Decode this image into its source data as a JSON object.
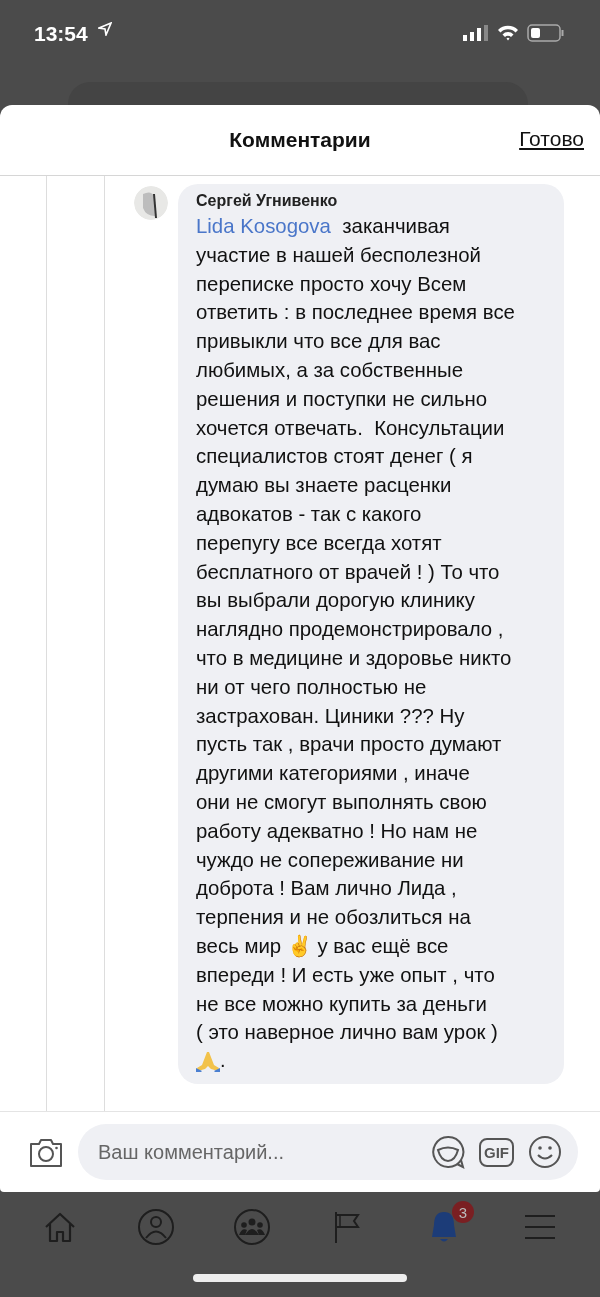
{
  "status_bar": {
    "time": "13:54"
  },
  "sheet": {
    "title": "Комментарии",
    "done_button": "Готово"
  },
  "comment": {
    "author": "Сергей Угнивенко",
    "mention": "Lida Kosogova",
    "text": "  заканчивая\nучастие в нашей бесполезной\nпереписке просто хочу Всем\nответить : в последнее время все\nпривыкли что все для вас\nлюбимых, а за собственные\nрешения и поступки не сильно\nхочется отвечать.  Консультации\nспециалистов стоят денег ( я\nдумаю вы знаете расценки\nадвокатов - так с какого\nперепугу все всегда хотят\nбесплатного от врачей ! ) То что\nвы выбрали дорогую клинику\nнаглядно продемонстрировало ,\nчто в медицине и здоровье никто\nни от чего полностью не\nзастрахован. Циники ??? Ну\nпусть так , врачи просто думают\nдругими категориями , иначе\nони не смогут выполнять свою\nработу адекватно ! Но нам не\nчуждо не сопереживание ни\nдоброта ! Вам лично Лида ,\nтерпения и не обозлиться на\nвесь мир ✌ у вас ещё все\nвпереди ! И есть уже опыт , что\nне все можно купить за деньги\n( это наверное лично вам урок )",
    "closing": "."
  },
  "composer": {
    "placeholder": "Ваш комментарий...",
    "gif_label": "GIF"
  },
  "tab_bar": {
    "items": [
      {
        "kind": "home",
        "selected": false
      },
      {
        "kind": "profile",
        "selected": false
      },
      {
        "kind": "groups",
        "selected": false
      },
      {
        "kind": "pages",
        "selected": false
      },
      {
        "kind": "notifications",
        "selected": true,
        "badge": "3"
      },
      {
        "kind": "menu",
        "selected": false
      }
    ]
  }
}
